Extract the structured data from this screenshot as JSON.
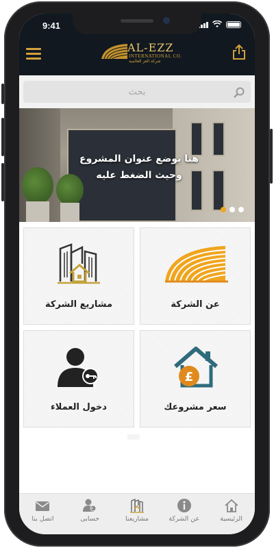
{
  "status_bar": {
    "time": "9:41"
  },
  "app_bar": {
    "logo_text": "AL-EZZ",
    "logo_subtitle": "INTERNATIONAL CO.",
    "logo_arabic": "شركة العز العالمية"
  },
  "search": {
    "placeholder": "بحث"
  },
  "banner": {
    "line1": "هنا يوضع عنوان المشروع",
    "line2": "وحيث الضغط عليه",
    "slide_count": 3,
    "active_slide": 0
  },
  "grid": {
    "items": [
      {
        "label": "عن الشركة",
        "icon": "company-logo-icon"
      },
      {
        "label": "مشاريع الشركة",
        "icon": "buildings-icon"
      },
      {
        "label": "سعر مشروعك",
        "icon": "house-price-icon"
      },
      {
        "label": "دخول العملاء",
        "icon": "user-key-icon"
      }
    ]
  },
  "tab_bar": {
    "items": [
      {
        "label": "الرئيسية",
        "icon": "home-icon"
      },
      {
        "label": "عن الشركة",
        "icon": "info-icon"
      },
      {
        "label": "مشاريعنا",
        "icon": "buildings-icon"
      },
      {
        "label": "حسابى",
        "icon": "account-icon"
      },
      {
        "label": "اتصل بنا",
        "icon": "mail-icon"
      }
    ]
  },
  "colors": {
    "brand_dark": "#111820",
    "brand_gold": "#d4a23a",
    "accent_orange": "#f0a51f",
    "house_teal": "#2f6b7c",
    "house_orange": "#e08a1e"
  }
}
